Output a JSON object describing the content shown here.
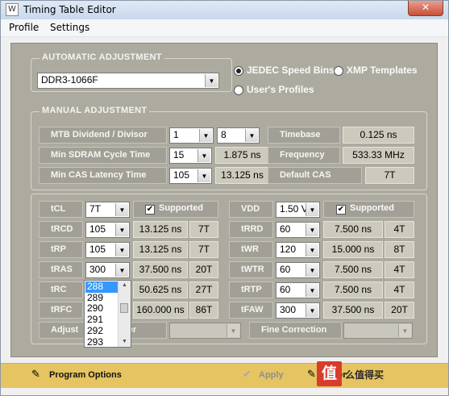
{
  "window": {
    "title": "Timing Table Editor",
    "close_glyph": "✕",
    "app_icon": "W"
  },
  "menu": [
    "Profile",
    "Settings"
  ],
  "automatic": {
    "title": "AUTOMATIC ADJUSTMENT",
    "profile_select": "DDR3-1066F",
    "radios": [
      {
        "label": "JEDEC Speed Bins",
        "selected": true
      },
      {
        "label": "XMP Templates",
        "selected": false
      },
      {
        "label": "User's Profiles",
        "selected": false
      }
    ]
  },
  "manual": {
    "title": "MANUAL ADJUSTMENT",
    "mtb_label": "MTB Dividend / Divisor",
    "mtb_dividend": "1",
    "mtb_divisor": "8",
    "timebase_label": "Timebase",
    "timebase_value": "0.125 ns",
    "cycle_label": "Min SDRAM Cycle Time",
    "cycle_select": "15",
    "cycle_value": "1.875 ns",
    "frequency_label": "Frequency",
    "frequency_value": "533.33 MHz",
    "cas_label": "Min CAS Latency Time",
    "cas_select": "105",
    "cas_value": "13.125 ns",
    "default_cas_label": "Default CAS",
    "default_cas_value": "7T"
  },
  "timings": {
    "tcl": {
      "label": "tCL",
      "select": "7T",
      "checkbox": "Supported"
    },
    "vdd": {
      "label": "VDD",
      "select": "1.50 V",
      "checkbox": "Supported"
    },
    "left": [
      {
        "label": "tRCD",
        "select": "105",
        "ns": "13.125 ns",
        "t": "7T"
      },
      {
        "label": "tRP",
        "select": "105",
        "ns": "13.125 ns",
        "t": "7T"
      },
      {
        "label": "tRAS",
        "select": "300",
        "ns": "37.500 ns",
        "t": "20T"
      },
      {
        "label": "tRC",
        "select": "",
        "ns": "50.625 ns",
        "t": "27T"
      },
      {
        "label": "tRFC",
        "select": "",
        "ns": "160.000 ns",
        "t": "86T"
      }
    ],
    "right": [
      {
        "label": "tRRD",
        "select": "60",
        "ns": "7.500 ns",
        "t": "4T"
      },
      {
        "label": "tWR",
        "select": "120",
        "ns": "15.000 ns",
        "t": "8T"
      },
      {
        "label": "tWTR",
        "select": "60",
        "ns": "7.500 ns",
        "t": "4T"
      },
      {
        "label": "tRTP",
        "select": "60",
        "ns": "7.500 ns",
        "t": "4T"
      },
      {
        "label": "tFAW",
        "select": "300",
        "ns": "37.500 ns",
        "t": "20T"
      }
    ],
    "adjust_label_left": "Adjust",
    "adjust_label_right": "eter",
    "fine_label": "Fine Correction"
  },
  "dropdown": {
    "items": [
      "288",
      "289",
      "290",
      "291",
      "292",
      "293"
    ],
    "selected_index": 0
  },
  "bottom": {
    "program_options": "Program Options",
    "apply": "Apply",
    "partial_text": "ver",
    "watermark_glyph": "值",
    "watermark_text": "么值得买"
  },
  "colors": {
    "panel": "#adaba0",
    "bottom_bar": "#e6c462",
    "selection": "#3399ff"
  }
}
